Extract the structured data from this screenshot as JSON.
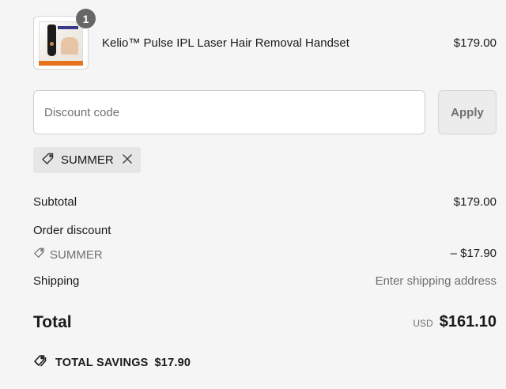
{
  "product": {
    "quantity": "1",
    "name": "Kelio™ Pulse IPL Laser Hair Removal Handset",
    "price": "$179.00"
  },
  "discount": {
    "placeholder": "Discount code",
    "value": "",
    "apply_label": "Apply",
    "applied_code": "SUMMER"
  },
  "summary": {
    "subtotal_label": "Subtotal",
    "subtotal_value": "$179.00",
    "order_discount_label": "Order discount",
    "discount_code": "SUMMER",
    "discount_value": "– $17.90",
    "shipping_label": "Shipping",
    "shipping_value": "Enter shipping address",
    "total_label": "Total",
    "currency": "USD",
    "total_value": "$161.10"
  },
  "savings": {
    "label": "TOTAL SAVINGS",
    "value": "$17.90"
  },
  "icons": {
    "tag": "tag-icon",
    "close": "close-icon",
    "tags": "tags-icon"
  }
}
